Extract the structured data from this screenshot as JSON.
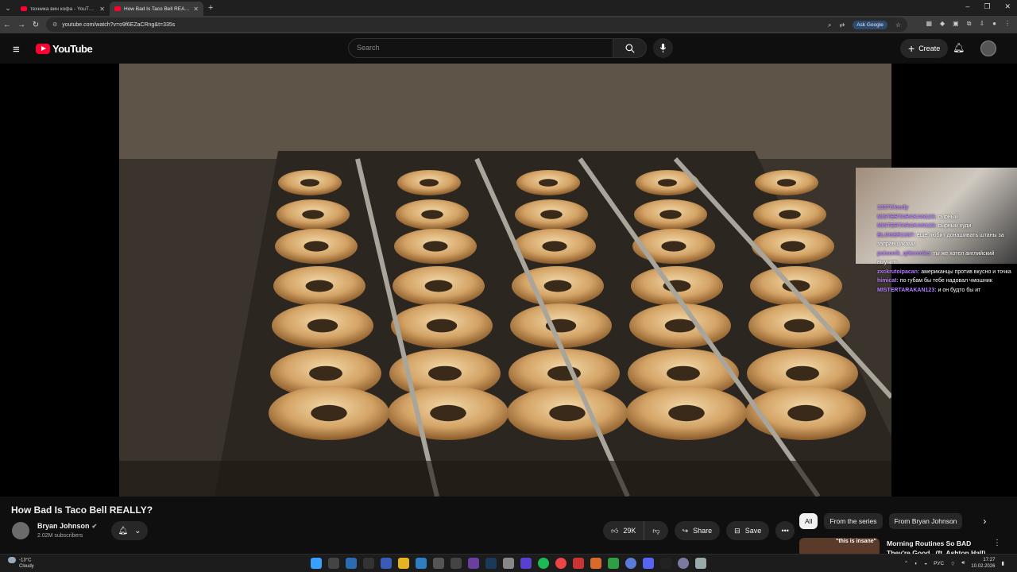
{
  "browser": {
    "tabs": [
      {
        "title": "техника вин кофа - YouTube",
        "active": false
      },
      {
        "title": "How Bad Is Taco Bell REALLY? -",
        "active": true
      }
    ],
    "url": "youtube.com/watch?v=o9f6EZaCRng&t=335s",
    "ask_google": "Ask Google"
  },
  "header": {
    "logo_text": "YouTube",
    "search_placeholder": "Search",
    "create_label": "Create"
  },
  "stream_chat": [
    {
      "user": "1337Cloudy",
      "msg": ""
    },
    {
      "user": "MISTERTARAKAN123:",
      "msg": "сырный"
    },
    {
      "user": "MISTERTARAKAN123:",
      "msg": "сырный худи"
    },
    {
      "user": "BLOGER1337:",
      "msg": "еще любит донашивать штаны за заправщиками"
    },
    {
      "user": "poisonik_q0terenko:",
      "msg": "ты же хотел английский выучить"
    },
    {
      "user": "zxckrutoipacan:",
      "msg": "американцы против вкусно и точка"
    },
    {
      "user": "himicat:",
      "msg": "по губам бы тебе надовал чмошник"
    },
    {
      "user": "MISTERTARAKAN123:",
      "msg": "и он будто бы ит"
    }
  ],
  "video": {
    "title": "How Bad Is Taco Bell REALLY?",
    "channel": "Bryan Johnson",
    "subscribers": "2.02M subscribers",
    "likes": "29K",
    "share_label": "Share",
    "save_label": "Save"
  },
  "chips": [
    "All",
    "From the series",
    "From Bryan Johnson"
  ],
  "recommendation": {
    "title": "Morning Routines So BAD They're Good...(ft. Ashton Hall)",
    "thumb_text": "\"this is insane\""
  },
  "taskbar": {
    "weather_temp": "-13°C",
    "weather_text": "Cloudy",
    "lang": "РУС",
    "time": "17:27",
    "date": "10.02.2026"
  },
  "colors": {
    "yt_red": "#ff0033",
    "bg": "#0f0f0f",
    "chat_user": "#b57cff"
  }
}
